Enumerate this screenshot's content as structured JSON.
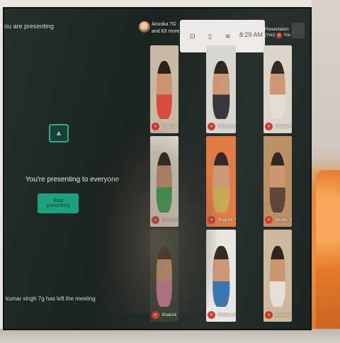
{
  "presenting_header": "ou are presenting",
  "presenting": {
    "message": "You're presenting to everyone",
    "stop_label": "Stop presenting",
    "arrow_icon": "up-arrow-icon"
  },
  "notification": "kumar singh 7g has left the meeting",
  "top_bar": {
    "participant_line1": "Anuska 7G",
    "participant_line2": "and 63 more",
    "presentation_line1": "Presentation",
    "presentation_line2": "(You)",
    "you_label": "You",
    "time": "8:29 AM"
  },
  "tiles": [
    {
      "name": "Tnishna 7D",
      "bg": "#c7b9a6",
      "shirt": "#d9493a"
    },
    {
      "name": "Utkarsh parihar Seventh e",
      "bg": "#d6d4cf",
      "shirt": "#2e2e34"
    },
    {
      "name": "Muskan 7th F",
      "bg": "#d9d3c7",
      "shirt": "#e2dcd3"
    },
    {
      "name": "Shivani Kumari 7g",
      "bg": "#e6e0d2",
      "shirt": "#2da44e"
    },
    {
      "name": "Shakshi 7D",
      "bg": "#e0743a",
      "shirt": "#c7a24f"
    },
    {
      "name": "Shubhi Samar 7g",
      "bg": "#b88c5e",
      "shirt": "#5b3f33"
    },
    {
      "name": "Shakshi 7th F Agarw",
      "bg": "#2c3a2a",
      "shirt": "#d27a9a"
    },
    {
      "name": "Sambeet Bhatnagar7F",
      "bg": "#e8e5e0",
      "shirt": "#2f6fb0"
    },
    {
      "name": "Shashti 7th G",
      "bg": "#cdb69b",
      "shirt": "#e6ddd1"
    }
  ]
}
